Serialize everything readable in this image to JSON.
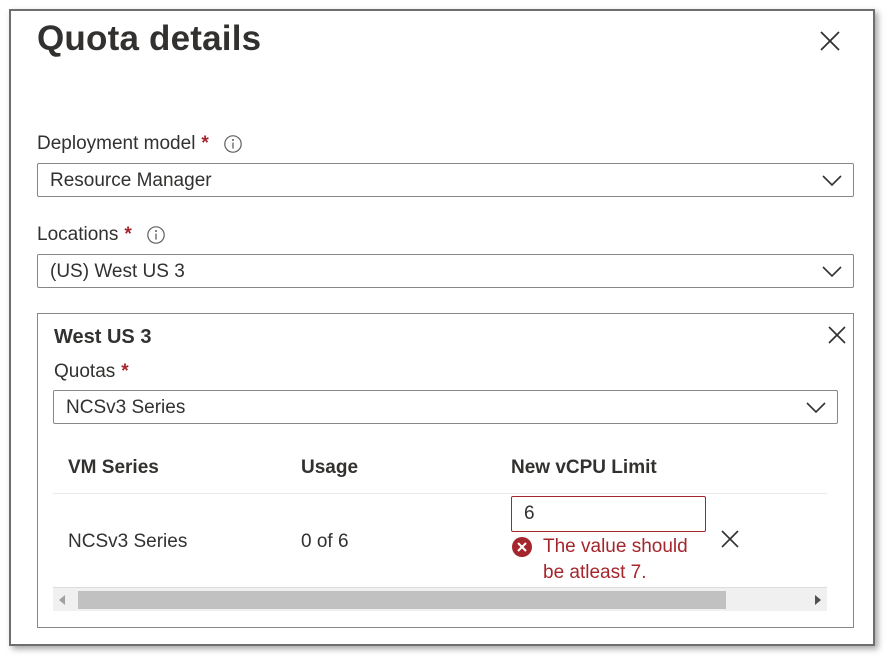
{
  "panel": {
    "title": "Quota details"
  },
  "deployment_model": {
    "label": "Deployment model",
    "required_mark": "*",
    "value": "Resource Manager"
  },
  "locations": {
    "label": "Locations",
    "required_mark": "*",
    "value": "(US) West US 3"
  },
  "region": {
    "title": "West US 3",
    "quotas_label": "Quotas",
    "required_mark": "*",
    "quotas_value": "NCSv3 Series",
    "table": {
      "headers": [
        "VM Series",
        "Usage",
        "New vCPU Limit"
      ],
      "rows": [
        {
          "vm_series": "NCSv3 Series",
          "usage": "0 of 6",
          "new_limit": "6",
          "error": "The value should be atleast 7."
        }
      ]
    }
  },
  "colors": {
    "error": "#a4262c",
    "border": "#8a8886",
    "text": "#323130"
  },
  "icons": {
    "close": "close-icon",
    "info": "info-icon",
    "chevron": "chevron-down-icon",
    "error": "error-circle-icon"
  }
}
